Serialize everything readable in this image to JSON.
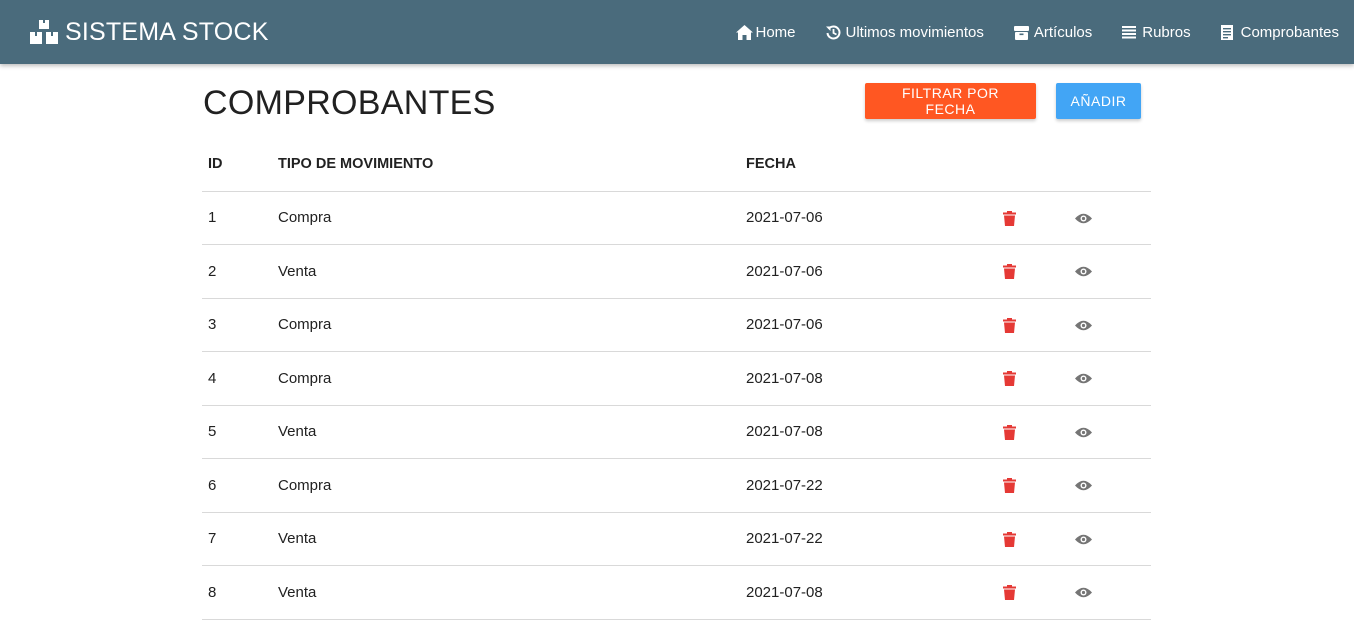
{
  "brand": {
    "title": "SISTEMA STOCK",
    "icon": "cubes-icon"
  },
  "nav": [
    {
      "label": "Home",
      "icon": "home-icon"
    },
    {
      "label": "Ultimos movimientos",
      "icon": "history-icon"
    },
    {
      "label": "Artículos",
      "icon": "archive-icon"
    },
    {
      "label": "Rubros",
      "icon": "list-icon"
    },
    {
      "label": "Comprobantes",
      "icon": "receipt-icon"
    }
  ],
  "page": {
    "title": "COMPROBANTES",
    "filter_button": "FILTRAR POR FECHA",
    "add_button": "AÑADIR"
  },
  "table": {
    "headers": [
      "ID",
      "TIPO DE MOVIMIENTO",
      "FECHA"
    ],
    "rows": [
      {
        "id": "1",
        "tipo": "Compra",
        "fecha": "2021-07-06"
      },
      {
        "id": "2",
        "tipo": "Venta",
        "fecha": "2021-07-06"
      },
      {
        "id": "3",
        "tipo": "Compra",
        "fecha": "2021-07-06"
      },
      {
        "id": "4",
        "tipo": "Compra",
        "fecha": "2021-07-08"
      },
      {
        "id": "5",
        "tipo": "Venta",
        "fecha": "2021-07-08"
      },
      {
        "id": "6",
        "tipo": "Compra",
        "fecha": "2021-07-22"
      },
      {
        "id": "7",
        "tipo": "Venta",
        "fecha": "2021-07-22"
      },
      {
        "id": "8",
        "tipo": "Venta",
        "fecha": "2021-07-08"
      }
    ]
  },
  "colors": {
    "navbar": "#4a6b7c",
    "filter_button": "#ff5722",
    "add_button": "#42a5f5",
    "delete_icon": "#e53935",
    "view_icon": "#757575"
  }
}
